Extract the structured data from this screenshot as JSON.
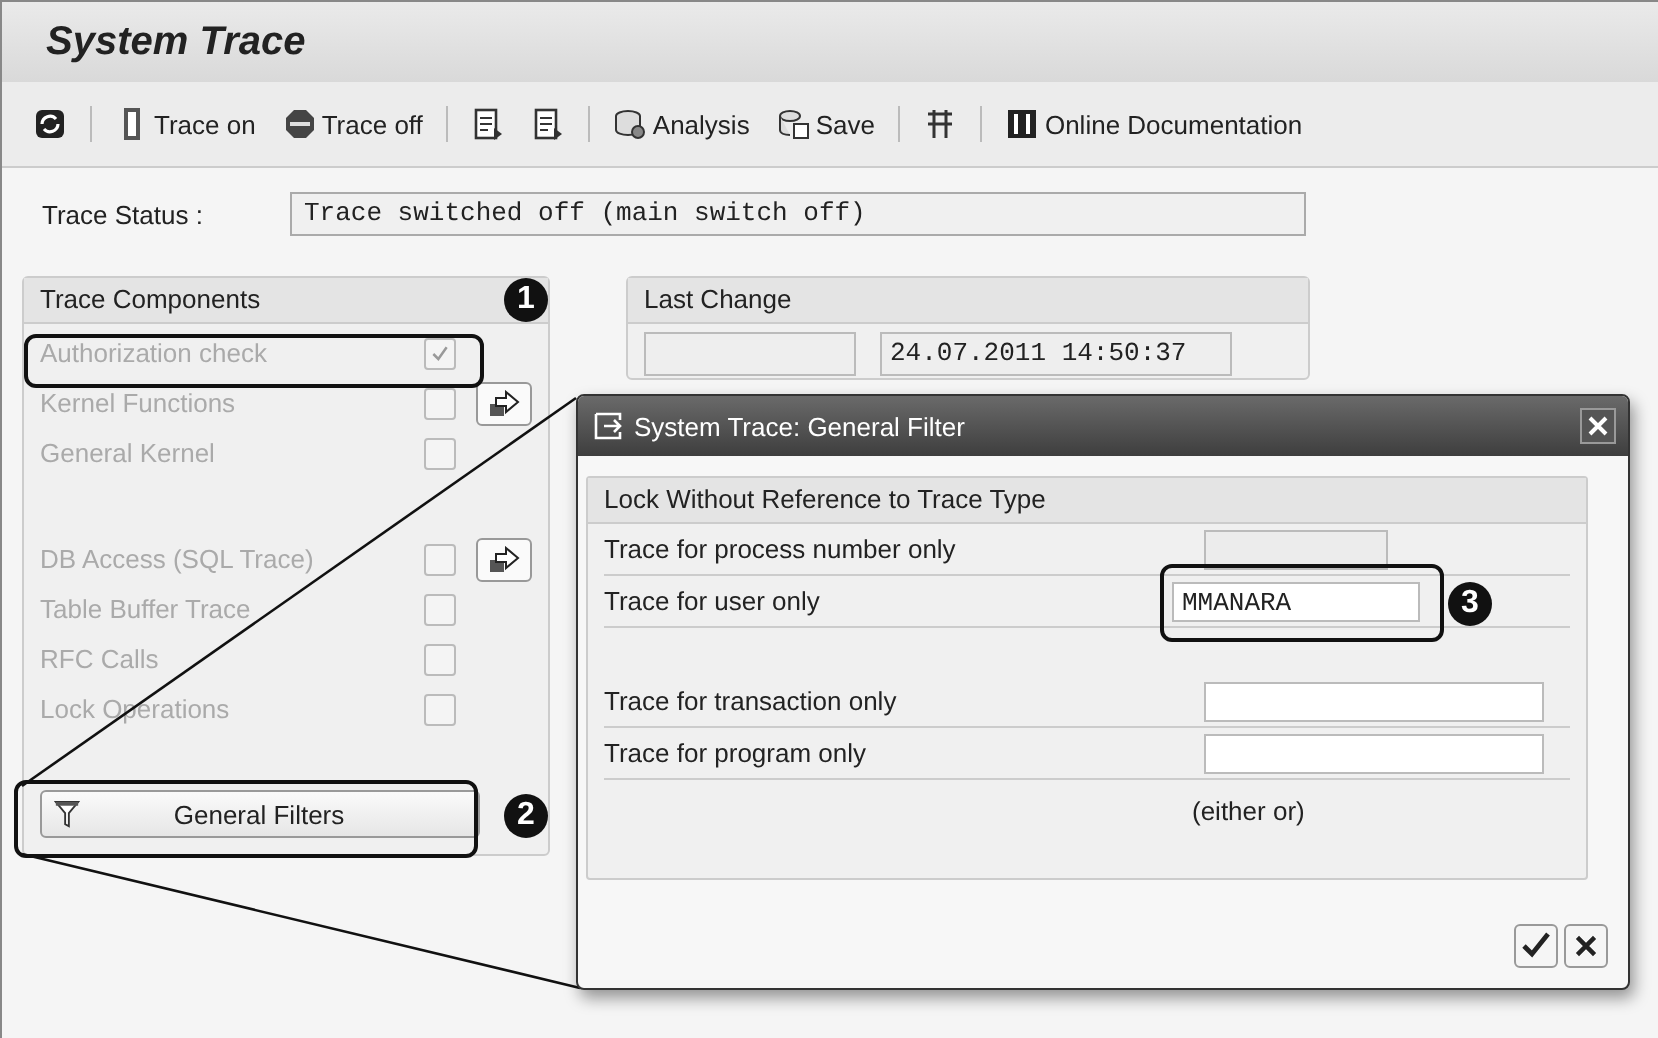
{
  "window": {
    "title": "System Trace"
  },
  "toolbar": {
    "groups": [
      [
        {
          "kind": "icon"
        }
      ],
      [
        {
          "kind": "labeled",
          "label": "Trace on"
        },
        {
          "kind": "labeled",
          "label": "Trace off"
        }
      ],
      [
        {
          "kind": "icon"
        },
        {
          "kind": "icon"
        }
      ],
      [
        {
          "kind": "labeled",
          "label": "Analysis"
        },
        {
          "kind": "labeled",
          "label": "Save"
        }
      ],
      [
        {
          "kind": "icon"
        }
      ],
      [
        {
          "kind": "labeled",
          "label": "Online Documentation"
        }
      ]
    ]
  },
  "status": {
    "label": "Trace Status :",
    "value": "Trace switched off (main switch off)"
  },
  "components": {
    "title": "Trace Components",
    "groups": [
      [
        {
          "label": "Authorization check",
          "checked": true,
          "disabled": true,
          "has_button": false
        },
        {
          "label": "Kernel Functions",
          "checked": false,
          "disabled": true,
          "has_button": true
        },
        {
          "label": "General Kernel",
          "checked": false,
          "disabled": true,
          "has_button": false
        }
      ],
      [
        {
          "label": "DB Access (SQL Trace)",
          "checked": false,
          "disabled": true,
          "has_button": true
        },
        {
          "label": "Table Buffer Trace",
          "checked": false,
          "disabled": true,
          "has_button": false
        },
        {
          "label": "RFC Calls",
          "checked": false,
          "disabled": true,
          "has_button": false
        },
        {
          "label": "Lock Operations",
          "checked": false,
          "disabled": true,
          "has_button": false
        }
      ]
    ],
    "filter_button": {
      "label": "General Filters"
    }
  },
  "last_change": {
    "title": "Last Change",
    "timestamp": "24.07.2011 14:50:37"
  },
  "dialog": {
    "title": "System Trace: General Filter",
    "group_title": "Lock Without Reference to Trace Type",
    "row_groups": [
      [
        {
          "label": "Trace for process number only",
          "disabled": true
        },
        {
          "label": "Trace for user only",
          "disabled": false,
          "value": "MMANARA"
        }
      ],
      [
        {
          "label": "Trace for transaction only",
          "disabled": false
        },
        {
          "label": "Trace for program only",
          "disabled": false
        }
      ]
    ],
    "note": "(either or)"
  },
  "callouts": [
    {
      "number": "1"
    },
    {
      "number": "2"
    },
    {
      "number": "3"
    }
  ]
}
